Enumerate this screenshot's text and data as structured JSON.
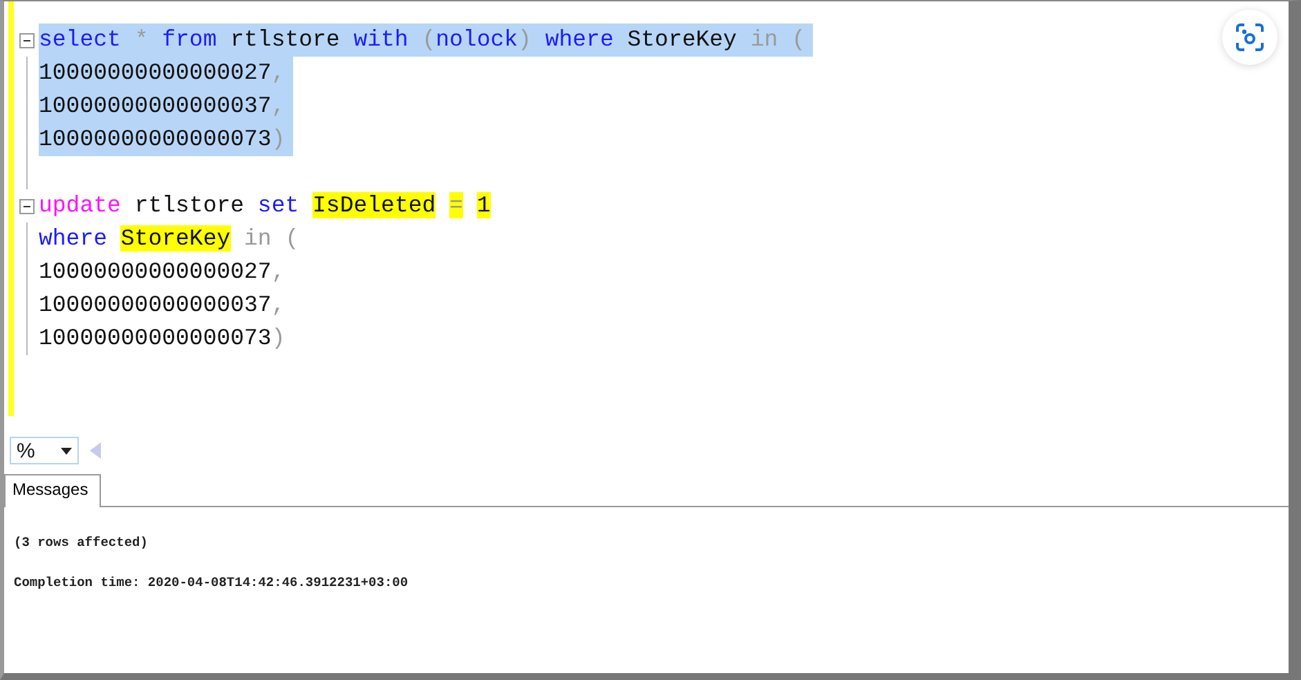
{
  "editor": {
    "lines": [
      {
        "selected": true,
        "collapsible": true,
        "tokens": [
          {
            "text": "select",
            "kind": "keyword",
            "highlighted": false,
            "space_before": false
          },
          {
            "text": "*",
            "kind": "operator",
            "highlighted": false,
            "space_before": true
          },
          {
            "text": "from",
            "kind": "keyword",
            "highlighted": false,
            "space_before": true
          },
          {
            "text": "rtlstore",
            "kind": "plain",
            "highlighted": false,
            "space_before": true
          },
          {
            "text": "with",
            "kind": "keyword",
            "highlighted": false,
            "space_before": true
          },
          {
            "text": "(",
            "kind": "operator",
            "highlighted": false,
            "space_before": true
          },
          {
            "text": "nolock",
            "kind": "keyword",
            "highlighted": false,
            "space_before": false
          },
          {
            "text": ")",
            "kind": "operator",
            "highlighted": false,
            "space_before": false
          },
          {
            "text": "where",
            "kind": "keyword",
            "highlighted": false,
            "space_before": true
          },
          {
            "text": "StoreKey",
            "kind": "plain",
            "highlighted": false,
            "space_before": true
          },
          {
            "text": "in",
            "kind": "operator",
            "highlighted": false,
            "space_before": true
          },
          {
            "text": "(",
            "kind": "operator",
            "highlighted": false,
            "space_before": true
          }
        ]
      },
      {
        "selected": true,
        "collapsible": false,
        "tokens": [
          {
            "text": "10000000000000027",
            "kind": "plain",
            "highlighted": false,
            "space_before": false
          },
          {
            "text": ",",
            "kind": "operator",
            "highlighted": false,
            "space_before": false
          }
        ]
      },
      {
        "selected": true,
        "collapsible": false,
        "tokens": [
          {
            "text": "10000000000000037",
            "kind": "plain",
            "highlighted": false,
            "space_before": false
          },
          {
            "text": ",",
            "kind": "operator",
            "highlighted": false,
            "space_before": false
          }
        ]
      },
      {
        "selected": true,
        "collapsible": false,
        "tokens": [
          {
            "text": "10000000000000073",
            "kind": "plain",
            "highlighted": false,
            "space_before": false
          },
          {
            "text": ")",
            "kind": "operator",
            "highlighted": false,
            "space_before": false
          }
        ]
      },
      {
        "selected": false,
        "collapsible": false
      },
      {
        "selected": false,
        "collapsible": true,
        "tokens": [
          {
            "text": "update",
            "kind": "function",
            "highlighted": false,
            "space_before": false
          },
          {
            "text": "rtlstore",
            "kind": "plain",
            "highlighted": false,
            "space_before": true
          },
          {
            "text": "set",
            "kind": "keyword",
            "highlighted": false,
            "space_before": true
          },
          {
            "text": "IsDeleted",
            "kind": "plain",
            "highlighted": true,
            "space_before": true
          },
          {
            "text": "=",
            "kind": "operator",
            "highlighted": true,
            "space_before": true
          },
          {
            "text": "1",
            "kind": "plain",
            "highlighted": true,
            "space_before": true
          }
        ]
      },
      {
        "selected": false,
        "collapsible": false,
        "tokens": [
          {
            "text": "where",
            "kind": "keyword",
            "highlighted": false,
            "space_before": false
          },
          {
            "text": "StoreKey",
            "kind": "plain",
            "highlighted": true,
            "space_before": true
          },
          {
            "text": "in",
            "kind": "operator",
            "highlighted": false,
            "space_before": true
          },
          {
            "text": "(",
            "kind": "operator",
            "highlighted": false,
            "space_before": true
          }
        ]
      },
      {
        "selected": false,
        "collapsible": false,
        "tokens": [
          {
            "text": "10000000000000027",
            "kind": "plain",
            "highlighted": false,
            "space_before": false
          },
          {
            "text": ",",
            "kind": "operator",
            "highlighted": false,
            "space_before": false
          }
        ]
      },
      {
        "selected": false,
        "collapsible": false,
        "tokens": [
          {
            "text": "10000000000000037",
            "kind": "plain",
            "highlighted": false,
            "space_before": false
          },
          {
            "text": ",",
            "kind": "operator",
            "highlighted": false,
            "space_before": false
          }
        ]
      },
      {
        "selected": false,
        "collapsible": false,
        "tokens": [
          {
            "text": "10000000000000073",
            "kind": "plain",
            "highlighted": false,
            "space_before": false
          },
          {
            "text": ")",
            "kind": "operator",
            "highlighted": false,
            "space_before": false
          }
        ]
      }
    ]
  },
  "zoom": {
    "value": "%"
  },
  "tabs": [
    {
      "label": "Messages",
      "selected": true
    }
  ],
  "messages": [
    "(3 rows affected)",
    "Completion time: 2020-04-08T14:42:46.3912231+03:00"
  ]
}
